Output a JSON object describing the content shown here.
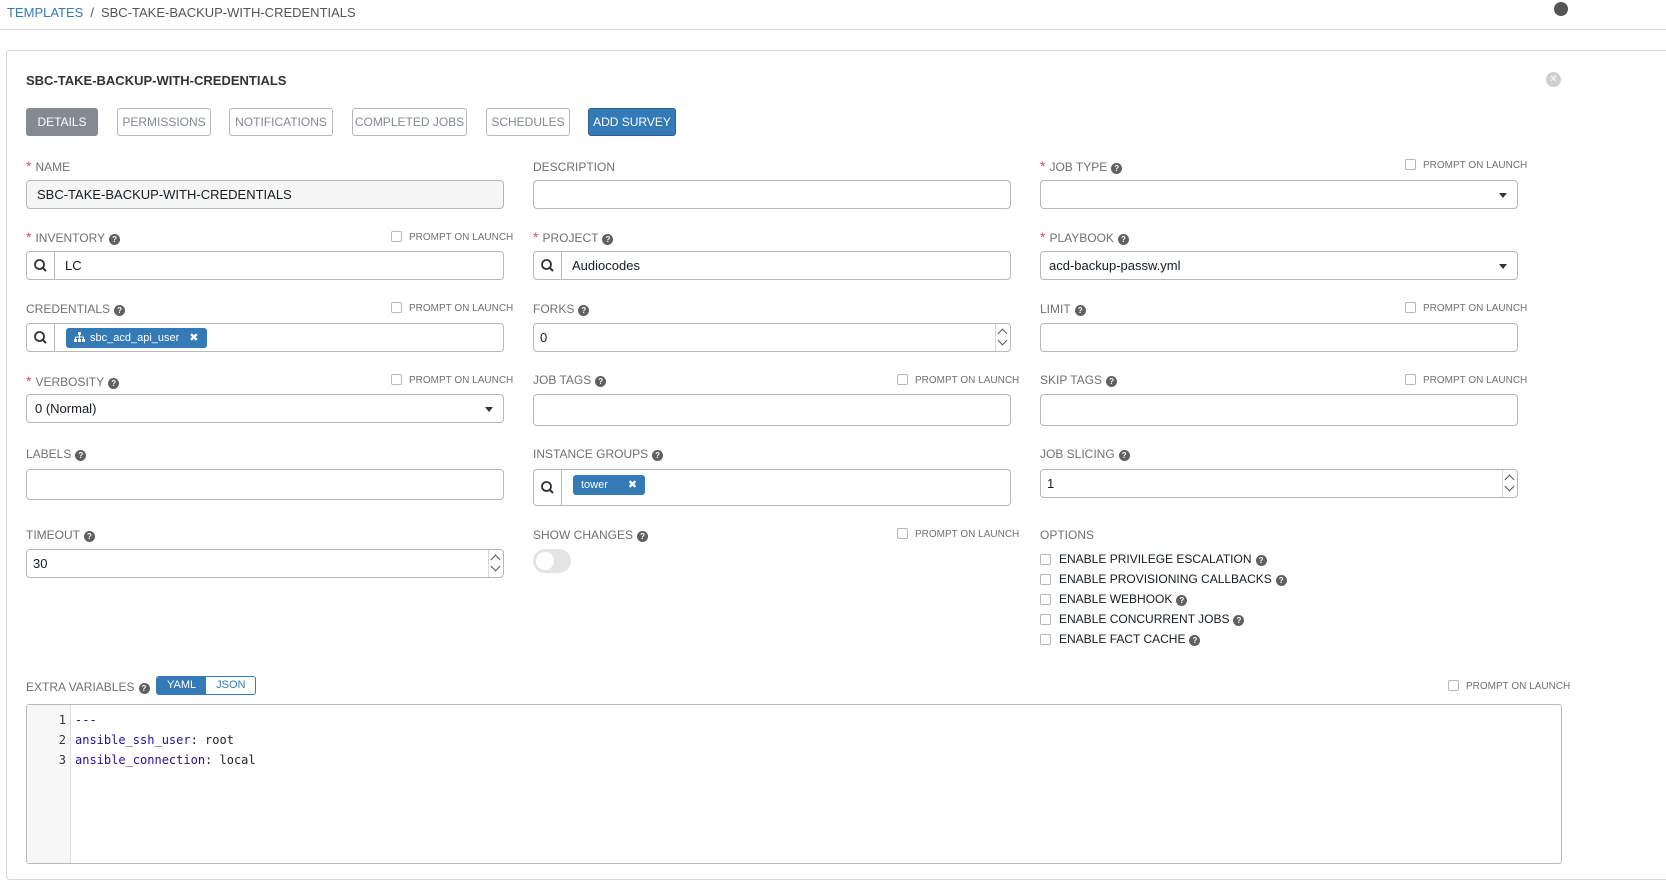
{
  "breadcrumb": {
    "root": "TEMPLATES",
    "separator": "/",
    "current": "SBC-TAKE-BACKUP-WITH-CREDENTIALS"
  },
  "panel": {
    "title": "SBC-TAKE-BACKUP-WITH-CREDENTIALS"
  },
  "tabs": [
    "DETAILS",
    "PERMISSIONS",
    "NOTIFICATIONS",
    "COMPLETED JOBS",
    "SCHEDULES",
    "ADD SURVEY"
  ],
  "prompt_on_launch": "PROMPT ON LAUNCH",
  "fields": {
    "name": {
      "label": "NAME",
      "value": "SBC-TAKE-BACKUP-WITH-CREDENTIALS"
    },
    "description": {
      "label": "DESCRIPTION",
      "value": ""
    },
    "job_type": {
      "label": "JOB TYPE",
      "value": ""
    },
    "inventory": {
      "label": "INVENTORY",
      "value": "LC"
    },
    "project": {
      "label": "PROJECT",
      "value": "Audiocodes"
    },
    "playbook": {
      "label": "PLAYBOOK",
      "value": "acd-backup-passw.yml"
    },
    "credentials": {
      "label": "CREDENTIALS",
      "chip": "sbc_acd_api_user"
    },
    "forks": {
      "label": "FORKS",
      "value": "0"
    },
    "limit": {
      "label": "LIMIT",
      "value": ""
    },
    "verbosity": {
      "label": "VERBOSITY",
      "value": "0 (Normal)"
    },
    "job_tags": {
      "label": "JOB TAGS",
      "value": ""
    },
    "skip_tags": {
      "label": "SKIP TAGS",
      "value": ""
    },
    "labels": {
      "label": "LABELS",
      "value": ""
    },
    "instance_groups": {
      "label": "INSTANCE GROUPS",
      "chip": "tower"
    },
    "job_slicing": {
      "label": "JOB SLICING",
      "value": "1"
    },
    "timeout": {
      "label": "TIMEOUT",
      "value": "30"
    },
    "show_changes": {
      "label": "SHOW CHANGES",
      "enabled": false
    }
  },
  "options": {
    "label": "OPTIONS",
    "items": [
      "ENABLE PRIVILEGE ESCALATION",
      "ENABLE PROVISIONING CALLBACKS",
      "ENABLE WEBHOOK",
      "ENABLE CONCURRENT JOBS",
      "ENABLE FACT CACHE"
    ]
  },
  "extra_vars": {
    "label": "EXTRA VARIABLES",
    "modes": [
      "YAML",
      "JSON"
    ],
    "lines": [
      {
        "num": "1",
        "key": "---",
        "value": ""
      },
      {
        "num": "2",
        "key": "ansible_ssh_user",
        "value": ": root"
      },
      {
        "num": "3",
        "key": "ansible_connection",
        "value": ": local"
      }
    ]
  },
  "colors": {
    "accent": "#337ab7",
    "required": "#d9534f",
    "active_tab": "#848992"
  }
}
